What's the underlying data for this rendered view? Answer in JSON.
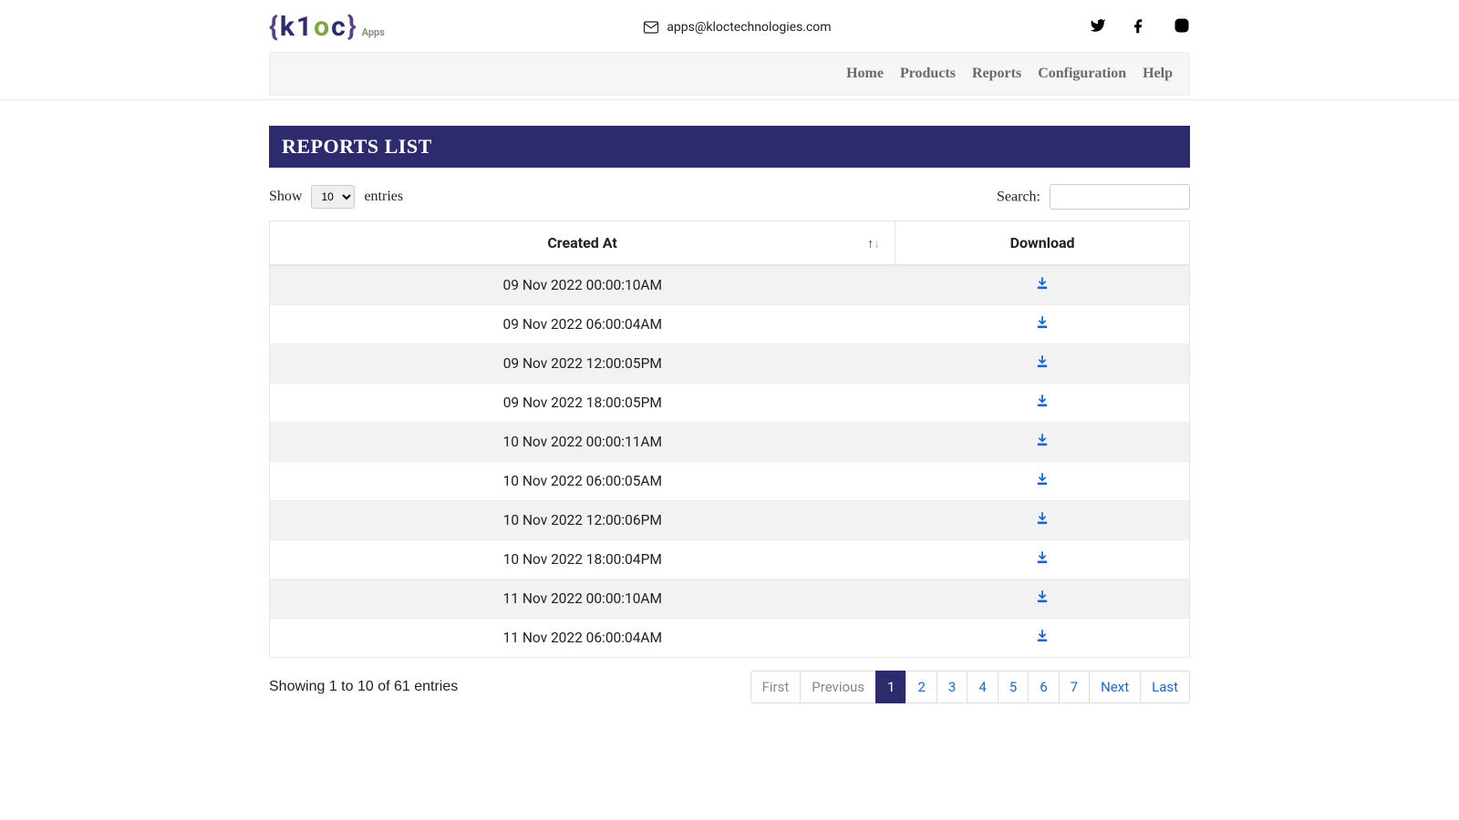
{
  "header": {
    "email": "apps@kloctechnologies.com",
    "logo_apps": "Apps"
  },
  "nav": {
    "home": "Home",
    "products": "Products",
    "reports": "Reports",
    "configuration": "Configuration",
    "help": "Help"
  },
  "page": {
    "title": "REPORTS LIST",
    "show_prefix": "Show",
    "show_suffix": "entries",
    "show_value": "10",
    "search_label": "Search:",
    "info": "Showing 1 to 10 of 61 entries"
  },
  "table": {
    "col_created": "Created At",
    "col_download": "Download",
    "rows": [
      {
        "created": "09 Nov 2022 00:00:10AM"
      },
      {
        "created": "09 Nov 2022 06:00:04AM"
      },
      {
        "created": "09 Nov 2022 12:00:05PM"
      },
      {
        "created": "09 Nov 2022 18:00:05PM"
      },
      {
        "created": "10 Nov 2022 00:00:11AM"
      },
      {
        "created": "10 Nov 2022 06:00:05AM"
      },
      {
        "created": "10 Nov 2022 12:00:06PM"
      },
      {
        "created": "10 Nov 2022 18:00:04PM"
      },
      {
        "created": "11 Nov 2022 00:00:10AM"
      },
      {
        "created": "11 Nov 2022 06:00:04AM"
      }
    ]
  },
  "pagination": {
    "first": "First",
    "previous": "Previous",
    "next": "Next",
    "last": "Last",
    "pages": [
      "1",
      "2",
      "3",
      "4",
      "5",
      "6",
      "7"
    ],
    "active": "1"
  }
}
